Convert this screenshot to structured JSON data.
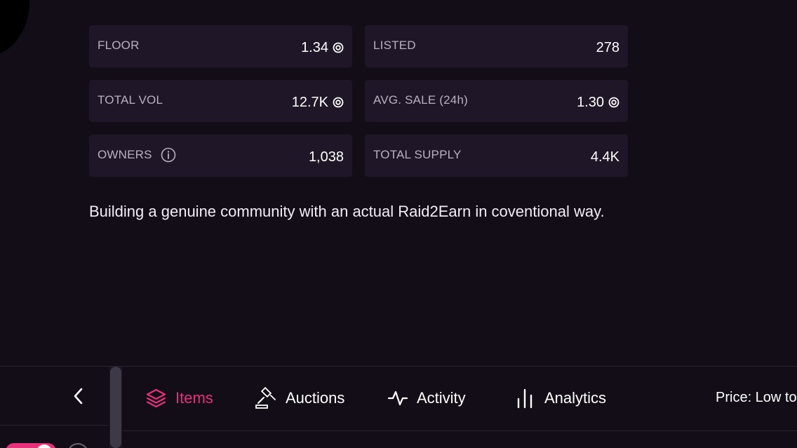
{
  "stats": [
    {
      "label": "FLOOR",
      "value": "1.34",
      "unit_icon": "sol-coin-icon",
      "has_info": false
    },
    {
      "label": "LISTED",
      "value": "278",
      "unit_icon": "",
      "has_info": false
    },
    {
      "label": "TOTAL VOL",
      "value": "12.7K",
      "unit_icon": "sol-coin-icon",
      "has_info": false
    },
    {
      "label": "AVG. SALE (24h)",
      "value": "1.30",
      "unit_icon": "sol-coin-icon",
      "has_info": false
    },
    {
      "label": "OWNERS",
      "value": "1,038",
      "unit_icon": "",
      "has_info": true
    },
    {
      "label": "TOTAL SUPPLY",
      "value": "4.4K",
      "unit_icon": "",
      "has_info": false
    }
  ],
  "description": "Building a genuine community with an actual Raid2Earn in coventional way.",
  "tabs": [
    {
      "label": "Items",
      "icon": "layers-icon",
      "active": true
    },
    {
      "label": "Auctions",
      "icon": "gavel-icon",
      "active": false
    },
    {
      "label": "Activity",
      "icon": "activity-icon",
      "active": false
    },
    {
      "label": "Analytics",
      "icon": "bar-chart-icon",
      "active": false
    }
  ],
  "sort": {
    "label": "Price: Low to"
  },
  "colors": {
    "background": "#130d18",
    "card": "#1f1628",
    "accent": "#e6317b",
    "muted_text": "#b9b1c2"
  }
}
